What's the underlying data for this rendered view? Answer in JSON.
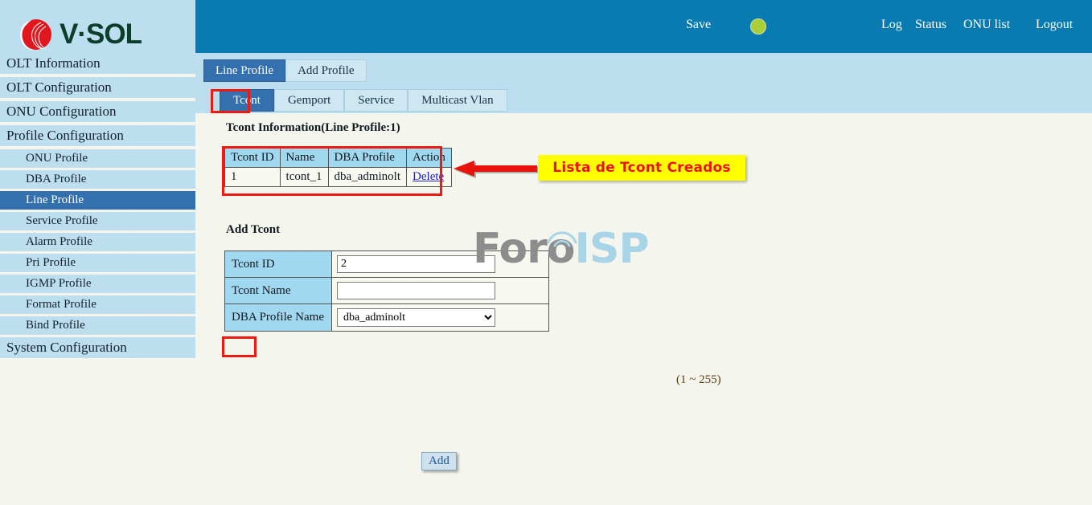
{
  "brand": {
    "name": "V·SOL",
    "logo_icon": "vsol-logo-icon"
  },
  "topbar": {
    "save_label": "Save",
    "indicator_color": "#a8ce3a",
    "links": [
      {
        "label": "Log"
      },
      {
        "label": "Status"
      },
      {
        "label": "ONU list"
      },
      {
        "label": "Logout"
      }
    ]
  },
  "sidebar": {
    "items": [
      {
        "label": "OLT Information",
        "level": 0,
        "active": false
      },
      {
        "label": "OLT Configuration",
        "level": 0,
        "active": false
      },
      {
        "label": "ONU Configuration",
        "level": 0,
        "active": false
      },
      {
        "label": "Profile Configuration",
        "level": 0,
        "active": false
      },
      {
        "label": "ONU Profile",
        "level": 1,
        "active": false
      },
      {
        "label": "DBA Profile",
        "level": 1,
        "active": false
      },
      {
        "label": "Line Profile",
        "level": 1,
        "active": true
      },
      {
        "label": "Service Profile",
        "level": 1,
        "active": false
      },
      {
        "label": "Alarm Profile",
        "level": 1,
        "active": false
      },
      {
        "label": "Pri Profile",
        "level": 1,
        "active": false
      },
      {
        "label": "IGMP Profile",
        "level": 1,
        "active": false
      },
      {
        "label": "Format Profile",
        "level": 1,
        "active": false
      },
      {
        "label": "Bind Profile",
        "level": 1,
        "active": false
      },
      {
        "label": "System Configuration",
        "level": 0,
        "active": false
      }
    ]
  },
  "tabs_primary": [
    {
      "label": "Line Profile",
      "selected": true
    },
    {
      "label": "Add Profile",
      "selected": false
    }
  ],
  "tabs_secondary": [
    {
      "label": "Tcont",
      "selected": true
    },
    {
      "label": "Gemport",
      "selected": false
    },
    {
      "label": "Service",
      "selected": false
    },
    {
      "label": "Multicast Vlan",
      "selected": false
    }
  ],
  "info_section": {
    "title": "Tcont Information(Line Profile:1)",
    "columns": [
      "Tcont ID",
      "Name",
      "DBA Profile",
      "Action"
    ],
    "rows": [
      {
        "tcont_id": "1",
        "name": "tcont_1",
        "dba_profile": "dba_adminolt",
        "action": "Delete"
      }
    ]
  },
  "add_section": {
    "title": "Add Tcont",
    "fields": [
      {
        "label": "Tcont ID",
        "value": "2",
        "placeholder": "",
        "hint": "(1 ~ 255)"
      },
      {
        "label": "Tcont Name",
        "value": "",
        "placeholder": "",
        "hint": ""
      },
      {
        "label": "DBA Profile Name",
        "value": "dba_adminolt",
        "options": [
          "dba_adminolt"
        ]
      }
    ],
    "submit_label": "Add"
  },
  "annotation": {
    "text": "Lista de Tcont Creados",
    "box_color": "#ffff00",
    "text_color": "#e8140c",
    "arrow_color": "#e8140c",
    "highlight_color": "#ee1b12"
  },
  "watermark": {
    "part1": "Foro",
    "part2": "ISP"
  },
  "colors": {
    "header_blue": "#0a7bb0",
    "sidebar_blue": "#bcdeef",
    "active_blue": "#3470ad",
    "content_bg": "#f4f6ee",
    "table_header": "#a0d8ef"
  }
}
